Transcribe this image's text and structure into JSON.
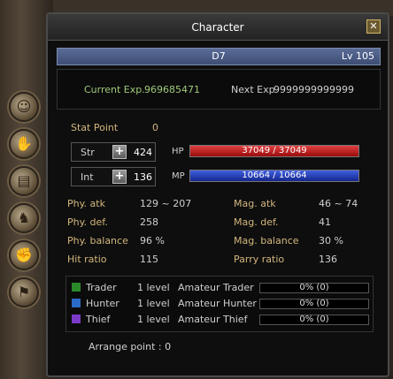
{
  "window": {
    "title": "Character",
    "close_symbol": "✕"
  },
  "character": {
    "name": "D7",
    "level": "Lv 105"
  },
  "exp": {
    "current_label": "Current Exp.",
    "current_value": "969685471",
    "next_label": "Next Exp",
    "next_value": "9999999999999"
  },
  "stat_point": {
    "label": "Stat Point",
    "value": "0"
  },
  "str": {
    "label": "Str",
    "value": "424"
  },
  "int": {
    "label": "Int",
    "value": "136"
  },
  "hp": {
    "label": "HP",
    "text": "37049 / 37049",
    "fill_fraction": 1.0,
    "color": "#d02020"
  },
  "mp": {
    "label": "MP",
    "text": "10664 / 10664",
    "fill_fraction": 1.0,
    "color": "#2840c0"
  },
  "stats_left": [
    {
      "label": "Phy. atk",
      "value": "129 ~ 207"
    },
    {
      "label": "Phy. def.",
      "value": "258"
    },
    {
      "label": "Phy. balance",
      "value": "96 %"
    },
    {
      "label": "Hit ratio",
      "value": "115"
    }
  ],
  "stats_right": [
    {
      "label": "Mag. atk",
      "value": "46 ~ 74"
    },
    {
      "label": "Mag. def.",
      "value": "41"
    },
    {
      "label": "Mag. balance",
      "value": "30 %"
    },
    {
      "label": "Parry ratio",
      "value": "136"
    }
  ],
  "jobs": [
    {
      "name": "Trader",
      "level": "1 level",
      "title": "Amateur Trader",
      "progress": "0% (0)",
      "icon": "trader-icon"
    },
    {
      "name": "Hunter",
      "level": "1 level",
      "title": "Amateur Hunter",
      "progress": "0% (0)",
      "icon": "hunter-icon"
    },
    {
      "name": "Thief",
      "level": "1 level",
      "title": "Amateur Thief",
      "progress": "0% (0)",
      "icon": "thief-icon"
    }
  ],
  "arrange": {
    "label": "Arrange point : 0"
  },
  "side_buttons": [
    "character-icon",
    "skill-icon",
    "quest-icon",
    "inventory-icon",
    "party-icon",
    "guild-icon"
  ]
}
